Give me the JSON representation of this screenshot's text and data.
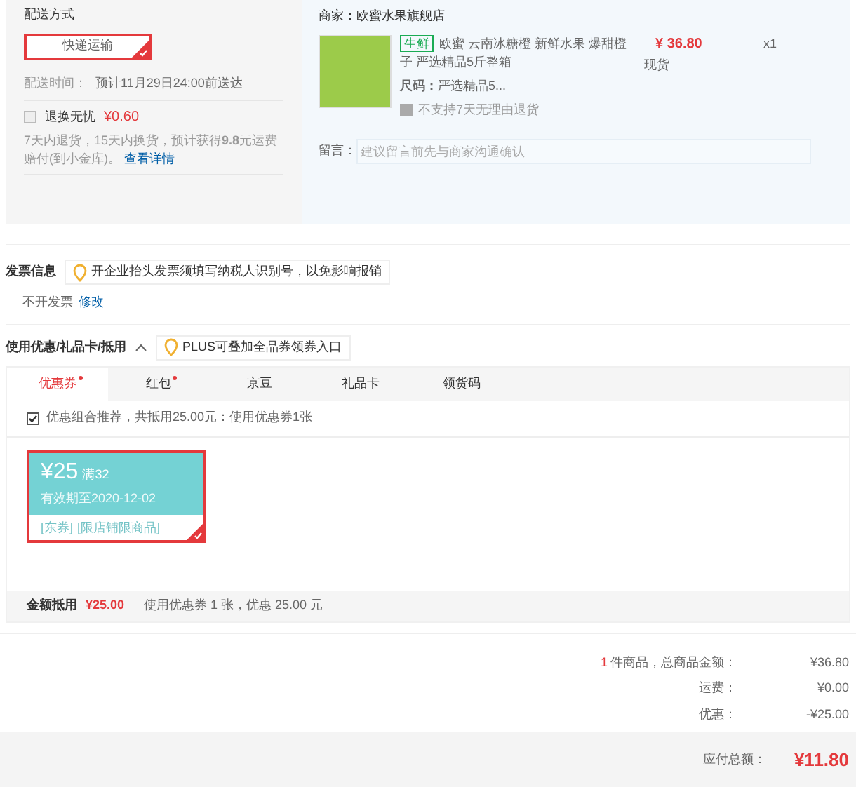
{
  "delivery": {
    "title": "配送方式",
    "option": {
      "label": "快递运输",
      "selected": true
    },
    "time_label": "配送时间：",
    "time_value": "预计11月29日24:00前送达",
    "insurance": {
      "label": "退换无忧",
      "price": "¥0.60",
      "checked": false
    },
    "insurance_note": "7天内退货，15天内换货，预计获得**9.8**元运费赔付(到小金库)。",
    "details_link": "查看详情"
  },
  "shop": {
    "label": "商家：",
    "name": "欧蜜水果旗舰店",
    "product": {
      "tag": "生鲜",
      "title": "欧蜜 云南冰糖橙 新鲜水果 爆甜橙子 严选精品5斤整箱",
      "spec_label": "尺码：",
      "spec_value": "严选精品5...",
      "return_note": "不支持7天无理由退货",
      "price": "¥ 36.80",
      "stock": "现货",
      "quantity": "x1"
    },
    "message_label": "留言：",
    "message_placeholder": "建议留言前先与商家沟通确认"
  },
  "invoice": {
    "title": "发票信息",
    "tip": "开企业抬头发票须填写纳税人识别号，以免影响报销",
    "value": "不开发票",
    "edit_link": "修改"
  },
  "discount": {
    "title": "使用优惠/礼品卡/抵用",
    "expanded": true,
    "tip": "PLUS可叠加全品券领券入口",
    "tabs": [
      {
        "label": "优惠券",
        "selected": true,
        "dot": true
      },
      {
        "label": "红包",
        "selected": false,
        "dot": true
      },
      {
        "label": "京豆",
        "selected": false,
        "dot": false
      },
      {
        "label": "礼品卡",
        "selected": false,
        "dot": false
      },
      {
        "label": "领货码",
        "selected": false,
        "dot": false
      }
    ],
    "recommend": {
      "checked": true,
      "label": "优惠组合推荐，共抵用25.00元：使用优惠券1张"
    },
    "coupons": [
      {
        "amount": "¥25",
        "condition": "满32",
        "validity": "有效期至2020-12-02",
        "tags": [
          "[东券]",
          "[限店铺限商品]"
        ],
        "selected": true
      }
    ],
    "footer_label": "金额抵用",
    "footer_amount": "¥25.00",
    "footer_note": "使用优惠券 1 张，优惠 25.00 元"
  },
  "summary": {
    "count": "1",
    "count_text": "件商品，总商品金额：",
    "rows": [
      {
        "label": "运费：",
        "value": "¥0.00"
      },
      {
        "label": "优惠：",
        "value": "-¥25.00"
      }
    ],
    "items_total": "¥36.80",
    "total_label": "应付总额：",
    "total_value": "¥11.80"
  }
}
